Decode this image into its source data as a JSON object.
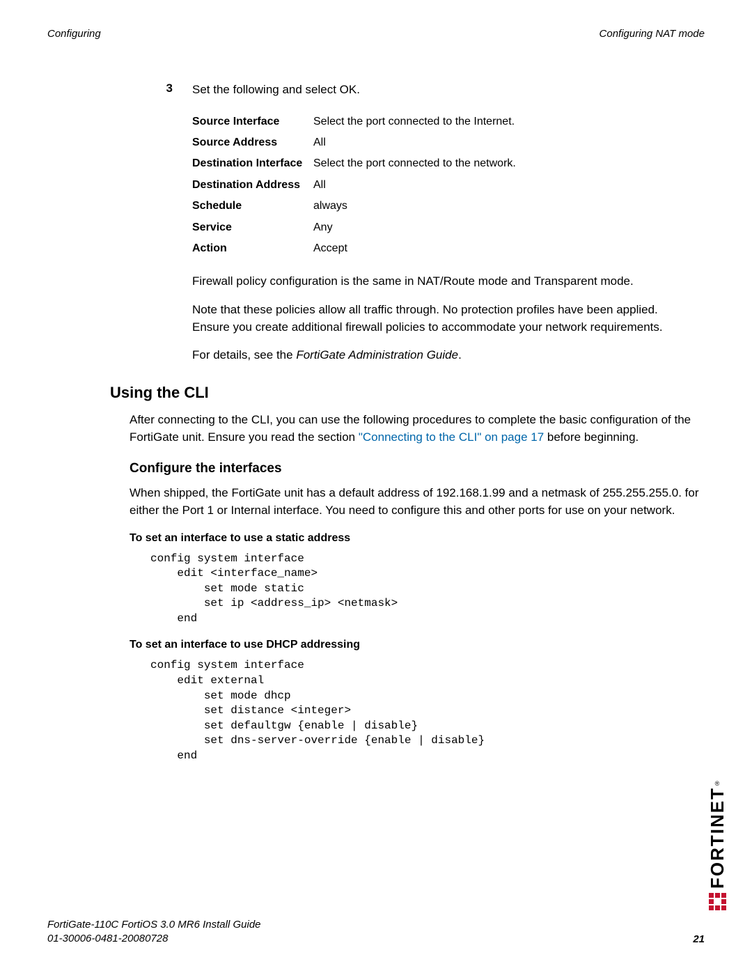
{
  "header": {
    "left": "Configuring",
    "right": "Configuring NAT mode"
  },
  "step": {
    "number": "3",
    "text": "Set the following and select OK."
  },
  "settings": [
    {
      "label": "Source Interface",
      "value": "Select the port connected to the Internet."
    },
    {
      "label": "Source Address",
      "value": "All"
    },
    {
      "label": "Destination Interface",
      "value": "Select the port connected to the network."
    },
    {
      "label": "Destination Address",
      "value": "All"
    },
    {
      "label": "Schedule",
      "value": "always"
    },
    {
      "label": "Service",
      "value": "Any"
    },
    {
      "label": "Action",
      "value": "Accept"
    }
  ],
  "p1": "Firewall policy configuration is the same in NAT/Route mode and Transparent mode.",
  "p2": "Note that these policies allow all traffic through. No protection profiles have been applied. Ensure you create additional firewall policies to accommodate your network requirements.",
  "p3_prefix": "For details, see the ",
  "p3_italic": "FortiGate Administration Guide",
  "p3_suffix": ".",
  "h2_cli": "Using the CLI",
  "cli_p_prefix": "After connecting to the CLI, you can use the following procedures to complete the basic configuration of the FortiGate unit. Ensure you read the section ",
  "cli_link": "\"Connecting to the CLI\" on page 17",
  "cli_p_suffix": " before beginning.",
  "h3_conf": "Configure the interfaces",
  "conf_p": "When shipped, the FortiGate unit has a default address of 192.168.1.99 and a netmask of 255.255.255.0. for either the Port 1 or Internal interface. You need to configure this and other ports for use on your network.",
  "h4_static": "To set an interface to use a static address",
  "code_static": "config system interface\n    edit <interface_name>\n        set mode static\n        set ip <address_ip> <netmask>\n    end",
  "h4_dhcp": "To set an interface to use DHCP addressing",
  "code_dhcp": "config system interface\n    edit external\n        set mode dhcp\n        set distance <integer>\n        set defaultgw {enable | disable}\n        set dns-server-override {enable | disable}\n    end",
  "footer": {
    "line1": "FortiGate-110C FortiOS 3.0 MR6 Install Guide",
    "line2": "01-30006-0481-20080728",
    "page": "21"
  },
  "brand": "FORTINET"
}
